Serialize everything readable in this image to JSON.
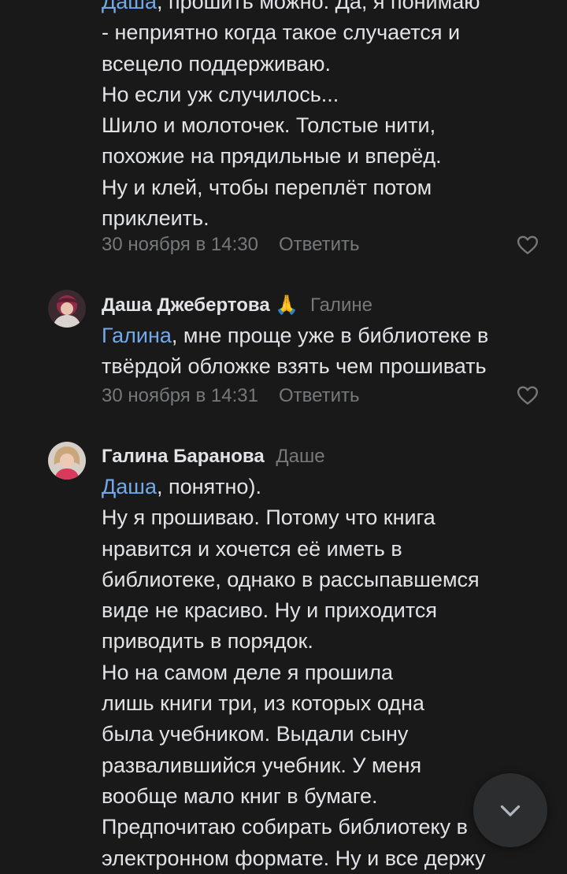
{
  "comments": [
    {
      "lines": [
        {
          "mention": "Даша",
          "rest": ", прошить можно. Да, я понимаю"
        },
        {
          "text": "- неприятно когда такое случается и"
        },
        {
          "text": "всецело поддерживаю."
        },
        {
          "text": "Но если уж случилось..."
        },
        {
          "text": "Шило и молоточек. Толстые нити,"
        },
        {
          "text": "похожие на прядильные и вперёд."
        },
        {
          "text": "Ну и клей, чтобы переплёт потом"
        },
        {
          "text": "приклеить."
        }
      ],
      "date": "30 ноября в 14:30",
      "reply_label": "Ответить"
    },
    {
      "author": "Даша Джебертова",
      "emoji": "🙏",
      "reply_to": "Галине",
      "lines": [
        {
          "mention": "Галина",
          "rest": ", мне проще уже в библиотеке в"
        },
        {
          "text": "твёрдой обложке взять чем прошивать"
        }
      ],
      "date": "30 ноября в 14:31",
      "reply_label": "Ответить"
    },
    {
      "author": "Галина Баранова",
      "reply_to": "Даше",
      "lines": [
        {
          "mention": "Даша",
          "rest": ", понятно)."
        },
        {
          "text": "Ну я прошиваю. Потому что книга"
        },
        {
          "text": "нравится и хочется её иметь в"
        },
        {
          "text": "библиотеке, однако в рассыпавшемся"
        },
        {
          "text": "виде не красиво. Ну и приходится"
        },
        {
          "text": "приводить в порядок."
        },
        {
          "text": "Но на самом деле я прошила"
        },
        {
          "text": "лишь книги три, из которых одна"
        },
        {
          "text": "была учебником. Выдали сыну"
        },
        {
          "text": "развалившийся учебник. У меня"
        },
        {
          "text": "вообще мало книг в бумаге."
        },
        {
          "text": "Предпочитаю собирать библиотеку в"
        },
        {
          "text": "электронном формате. Ну и все держу"
        }
      ]
    }
  ],
  "icons": {
    "like": "heart-outline-icon",
    "scroll_down": "chevron-down-icon"
  },
  "colors": {
    "background": "#19191a",
    "text": "#e1e3e6",
    "secondary": "#76787a",
    "link": "#71aaeb"
  }
}
